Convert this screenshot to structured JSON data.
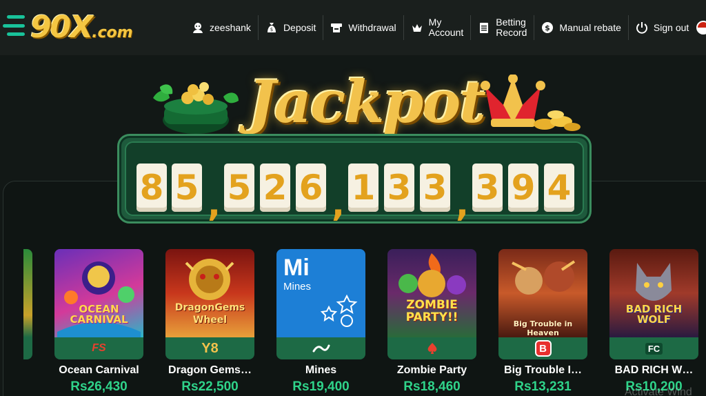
{
  "brand": {
    "logo_main": "90X",
    "logo_domain": ".com"
  },
  "nav": {
    "username": "zeeshank",
    "deposit": "Deposit",
    "withdrawal": "Withdrawal",
    "my_account": "My\nAccount",
    "betting_record": "Betting\nRecord",
    "manual_rebate": "Manual rebate",
    "sign_out": "Sign out"
  },
  "jackpot": {
    "title": "Jackpot",
    "digits": [
      "8",
      "5",
      "5",
      "2",
      "6",
      "1",
      "3",
      "3",
      "3",
      "9",
      "4"
    ]
  },
  "games": [
    {
      "name": "Ocean Carnival",
      "amount": "Rs26,430",
      "thumb_title": "OCEAN\nCARNIVAL",
      "provider": "FS",
      "icon": "fs-provider-icon"
    },
    {
      "name": "Dragon Gems…",
      "amount": "Rs22,500",
      "thumb_title": "DragonGems\nWheel",
      "provider": "Y8",
      "icon": "y8-provider-icon"
    },
    {
      "name": "Mines",
      "amount": "Rs19,400",
      "thumb_title": "Mi",
      "thumb_sub": "Mines",
      "provider": "link",
      "icon": "link-provider-icon"
    },
    {
      "name": "Zombie Party",
      "amount": "Rs18,460",
      "thumb_title": "ZOMBIE\nPARTY!!",
      "provider": "spade",
      "icon": "spade-provider-icon"
    },
    {
      "name": "Big Trouble I…",
      "amount": "Rs13,231",
      "thumb_title": "Big Trouble in Heaven",
      "provider": "B",
      "icon": "b-provider-icon"
    },
    {
      "name": "BAD RICH W…",
      "amount": "Rs10,200",
      "thumb_title": "BAD RICH\nWOLF",
      "provider": "FC",
      "icon": "fc-provider-icon"
    }
  ],
  "watermark": "Activate Wind",
  "colors": {
    "accent": "#19c29a",
    "gold": "#f2c24c",
    "amount": "#2fd38a",
    "provider_bar": "#1d6a45"
  }
}
